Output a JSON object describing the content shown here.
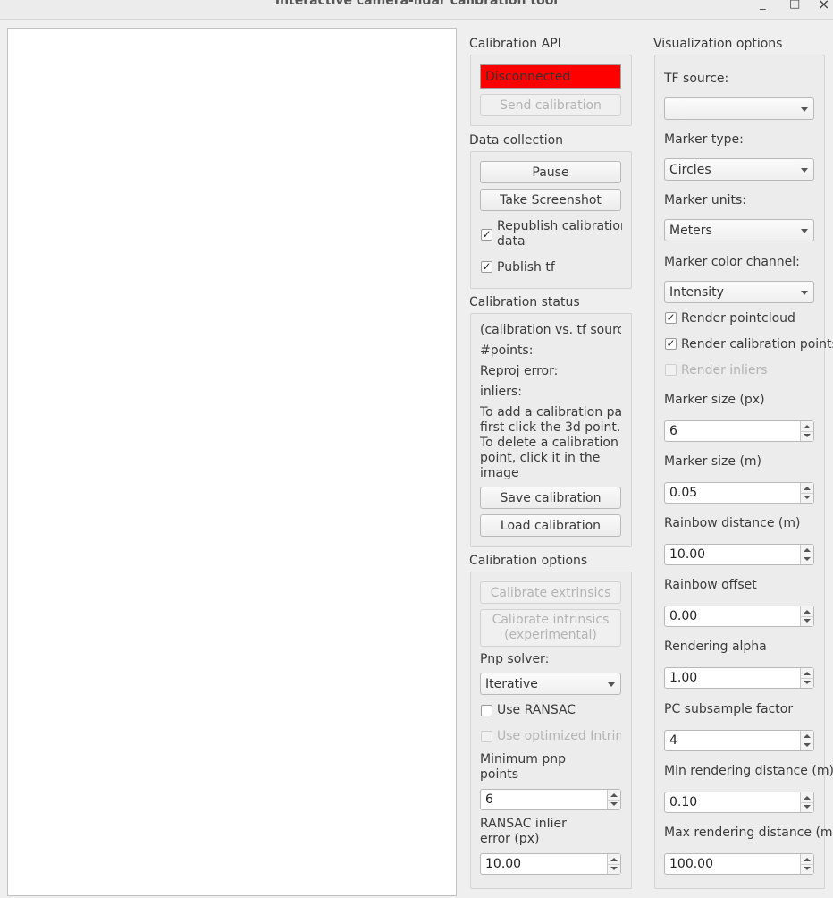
{
  "window": {
    "title": "Interactive camera-lidar calibration tool",
    "minimize": "_",
    "maximize": "□",
    "close": "×"
  },
  "calibration_api": {
    "title": "Calibration API",
    "status": "Disconnected",
    "status_color": "#ff0000",
    "send_button": "Send calibration"
  },
  "data_collection": {
    "title": "Data collection",
    "pause_button": "Pause",
    "screenshot_button": "Take Screenshot",
    "republish_label_line1": "Republish calibration",
    "republish_label_line2": "data",
    "republish_checked": "✓",
    "publish_tf_label": "Publish tf",
    "publish_tf_checked": "✓"
  },
  "calibration_status": {
    "title": "Calibration status",
    "source_text": "(calibration vs. tf source)",
    "points_label": "#points:",
    "reproj_label": "Reproj error:",
    "inliers_label": "inliers:",
    "instructions": [
      "To add a calibration pair,",
      "first click the 3d point.",
      "To delete a calibration",
      "point, click it in the",
      "image"
    ],
    "save_button": "Save calibration",
    "load_button": "Load calibration"
  },
  "calibration_options": {
    "title": "Calibration options",
    "extrinsics_button": "Calibrate extrinsics",
    "intrinsics_button_line1": "Calibrate intrinsics",
    "intrinsics_button_line2": "(experimental)",
    "pnp_solver_label": "Pnp solver:",
    "pnp_solver_value": "Iterative",
    "use_ransac_label": "Use RANSAC",
    "use_optimized_label": "Use optimized Intrinsics",
    "min_pnp_label_line1": "Minimum pnp",
    "min_pnp_label_line2": " points",
    "min_pnp_value": "6",
    "ransac_error_label_line1": "RANSAC inlier",
    "ransac_error_label_line2": "error (px)",
    "ransac_error_value": "10.00"
  },
  "visualization": {
    "title": "Visualization options",
    "tf_source_label": "TF source:",
    "tf_source_value": "",
    "marker_type_label": "Marker type:",
    "marker_type_value": "Circles",
    "marker_units_label": "Marker units:",
    "marker_units_value": "Meters",
    "marker_color_label": "Marker color channel:",
    "marker_color_value": "Intensity",
    "render_pointcloud_label": "Render pointcloud",
    "render_pointcloud_checked": "✓",
    "render_calib_points_label": "Render calibration points",
    "render_calib_points_checked": "✓",
    "render_inliers_label": "Render inliers",
    "marker_size_px_label": "Marker size (px)",
    "marker_size_px_value": "6",
    "marker_size_m_label": "Marker size (m)",
    "marker_size_m_value": "0.05",
    "rainbow_distance_label": "Rainbow distance (m)",
    "rainbow_distance_value": "10.00",
    "rainbow_offset_label": "Rainbow offset",
    "rainbow_offset_value": "0.00",
    "rendering_alpha_label": "Rendering alpha",
    "rendering_alpha_value": "1.00",
    "pc_subsample_label": "PC subsample factor",
    "pc_subsample_value": "4",
    "min_render_label": "Min rendering distance (m)",
    "min_render_value": "0.10",
    "max_render_label": "Max rendering distance (m)",
    "max_render_value": "100.00"
  }
}
